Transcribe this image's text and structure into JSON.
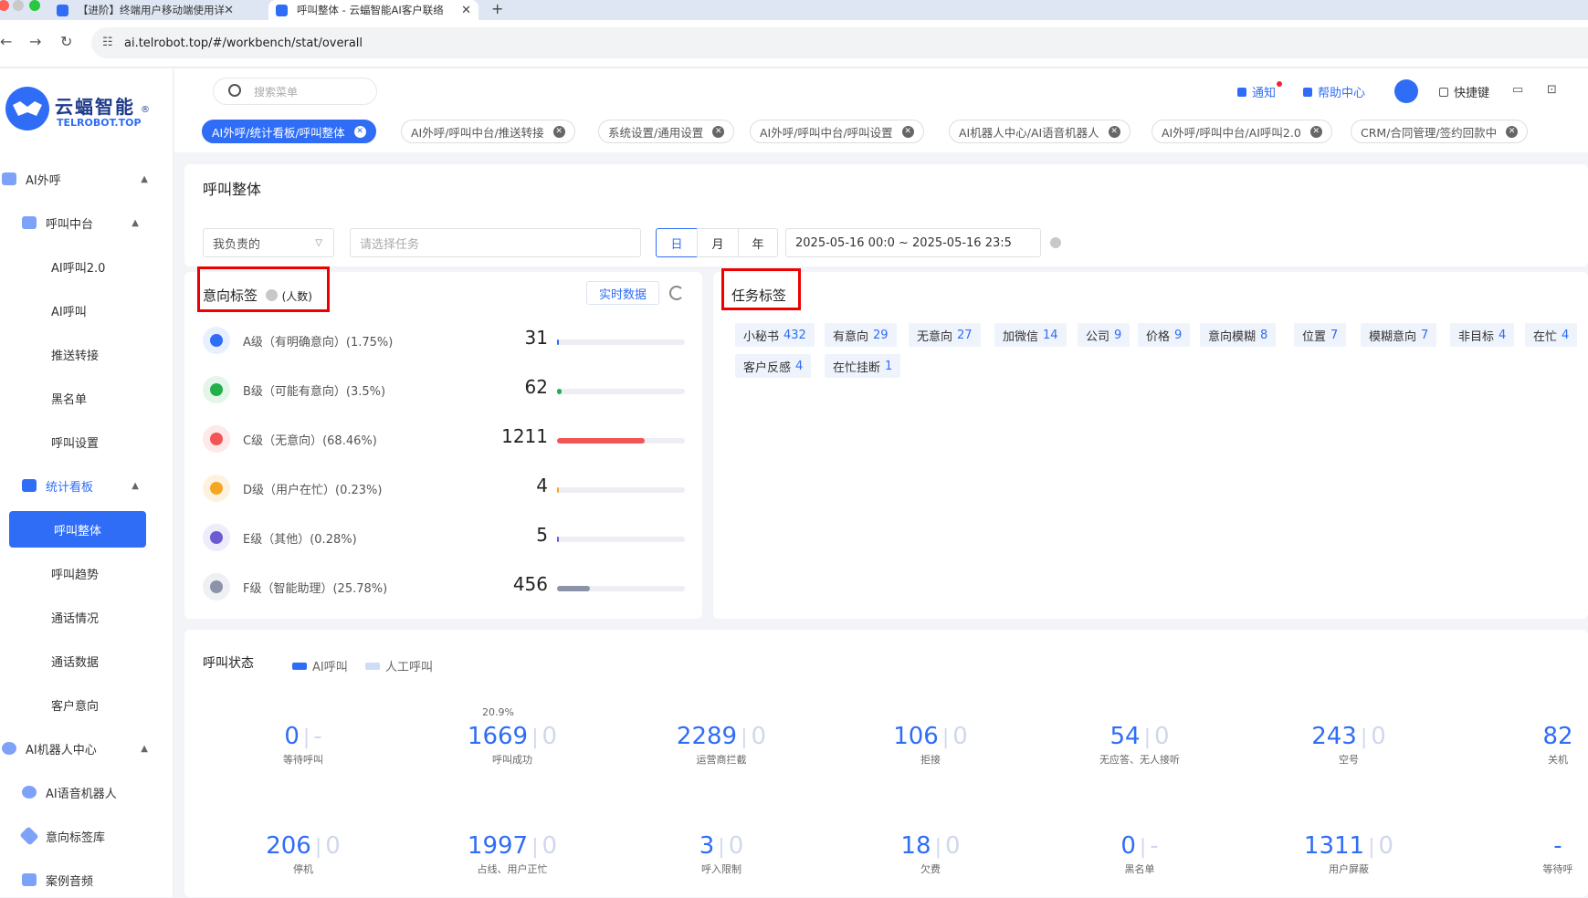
{
  "browser": {
    "tabs": [
      {
        "title": "【进阶】终端用户移动端使用详",
        "close": "✕"
      },
      {
        "title": "呼叫整体 - 云蝠智能AI客户联络",
        "close": "✕"
      }
    ],
    "new_tab": "+",
    "url": "ai.telrobot.top/#/workbench/stat/overall"
  },
  "logo": {
    "cn": "云蝠智能",
    "en": "TELROBOT.TOP",
    "reg": "®"
  },
  "sidebar": {
    "groups": [
      {
        "label": "AI外呼"
      },
      {
        "label": "呼叫中台"
      },
      {
        "label": "统计看板"
      },
      {
        "label": "AI机器人中心"
      }
    ],
    "items": [
      {
        "label": "AI呼叫2.0"
      },
      {
        "label": "AI呼叫"
      },
      {
        "label": "推送转接"
      },
      {
        "label": "黑名单"
      },
      {
        "label": "呼叫设置"
      },
      {
        "label": "呼叫整体"
      },
      {
        "label": "呼叫趋势"
      },
      {
        "label": "通话情况"
      },
      {
        "label": "通话数据"
      },
      {
        "label": "客户意向"
      },
      {
        "label": "AI语音机器人"
      },
      {
        "label": "意向标签库"
      },
      {
        "label": "案例音频"
      }
    ]
  },
  "topbar": {
    "search_placeholder": "搜索菜单",
    "notify": "通知",
    "help": "帮助中心",
    "shortcut": "快捷键"
  },
  "page_tabs": [
    {
      "label": "AI外呼/统计看板/呼叫整体"
    },
    {
      "label": "AI外呼/呼叫中台/推送转接"
    },
    {
      "label": "系统设置/通用设置"
    },
    {
      "label": "AI外呼/呼叫中台/呼叫设置"
    },
    {
      "label": "AI机器人中心/AI语音机器人"
    },
    {
      "label": "AI外呼/呼叫中台/AI呼叫2.0"
    },
    {
      "label": "CRM/合同管理/签约回款中"
    }
  ],
  "page": {
    "title": "呼叫整体",
    "filter_owner": "我负责的",
    "filter_task_placeholder": "请选择任务",
    "seg": [
      "日",
      "月",
      "年"
    ],
    "date_range": "2025-05-16 00:0 ~ 2025-05-16 23:5"
  },
  "intent": {
    "title": "意向标签",
    "unit": "(人数)",
    "realtime": "实时数据",
    "rows": [
      {
        "label": "A级（有明确意向）(1.75%)",
        "value": "31",
        "pct": 1.75,
        "color": "#2f6df6",
        "bg": "#e8efff"
      },
      {
        "label": "B级（可能有意向）(3.5%)",
        "value": "62",
        "pct": 3.5,
        "color": "#22b04b",
        "bg": "#e4f6ea"
      },
      {
        "label": "C级（无意向）(68.46%)",
        "value": "1211",
        "pct": 68.46,
        "color": "#f25555",
        "bg": "#fde9e9"
      },
      {
        "label": "D级（用户在忙）(0.23%)",
        "value": "4",
        "pct": 0.23,
        "color": "#f5a623",
        "bg": "#fdf2df"
      },
      {
        "label": "E级（其他）(0.28%)",
        "value": "5",
        "pct": 0.28,
        "color": "#6b5cd6",
        "bg": "#eeebfb"
      },
      {
        "label": "F级（智能助理）(25.78%)",
        "value": "456",
        "pct": 25.78,
        "color": "#8c93a8",
        "bg": "#eef0f4"
      }
    ]
  },
  "task_tags": {
    "title": "任务标签",
    "chips": [
      {
        "name": "小秘书",
        "count": "432"
      },
      {
        "name": "有意向",
        "count": "29"
      },
      {
        "name": "无意向",
        "count": "27"
      },
      {
        "name": "加微信",
        "count": "14"
      },
      {
        "name": "公司",
        "count": "9"
      },
      {
        "name": "价格",
        "count": "9"
      },
      {
        "name": "意向模糊",
        "count": "8"
      },
      {
        "name": "位置",
        "count": "7"
      },
      {
        "name": "模糊意向",
        "count": "7"
      },
      {
        "name": "非目标",
        "count": "4"
      },
      {
        "name": "在忙",
        "count": "4"
      },
      {
        "name": "客户反感",
        "count": "4"
      },
      {
        "name": "在忙挂断",
        "count": "1"
      }
    ]
  },
  "call_status": {
    "title": "呼叫状态",
    "legend_ai": "AI呼叫",
    "legend_manual": "人工呼叫",
    "success_pct": "20.9%",
    "stats": [
      {
        "ai": "0",
        "manual": "-",
        "label": "等待呼叫"
      },
      {
        "ai": "1669",
        "manual": "0",
        "label": "呼叫成功"
      },
      {
        "ai": "2289",
        "manual": "0",
        "label": "运营商拦截"
      },
      {
        "ai": "106",
        "manual": "0",
        "label": "拒接"
      },
      {
        "ai": "54",
        "manual": "0",
        "label": "无应答、无人接听"
      },
      {
        "ai": "243",
        "manual": "0",
        "label": "空号"
      },
      {
        "ai": "82",
        "manual": "",
        "label": "关机"
      },
      {
        "ai": "206",
        "manual": "0",
        "label": "停机"
      },
      {
        "ai": "1997",
        "manual": "0",
        "label": "占线、用户正忙"
      },
      {
        "ai": "3",
        "manual": "0",
        "label": "呼入限制"
      },
      {
        "ai": "18",
        "manual": "0",
        "label": "欠费"
      },
      {
        "ai": "0",
        "manual": "-",
        "label": "黑名单"
      },
      {
        "ai": "1311",
        "manual": "0",
        "label": "用户屏蔽"
      },
      {
        "ai": "-",
        "manual": "",
        "label": "等待呼"
      }
    ]
  }
}
